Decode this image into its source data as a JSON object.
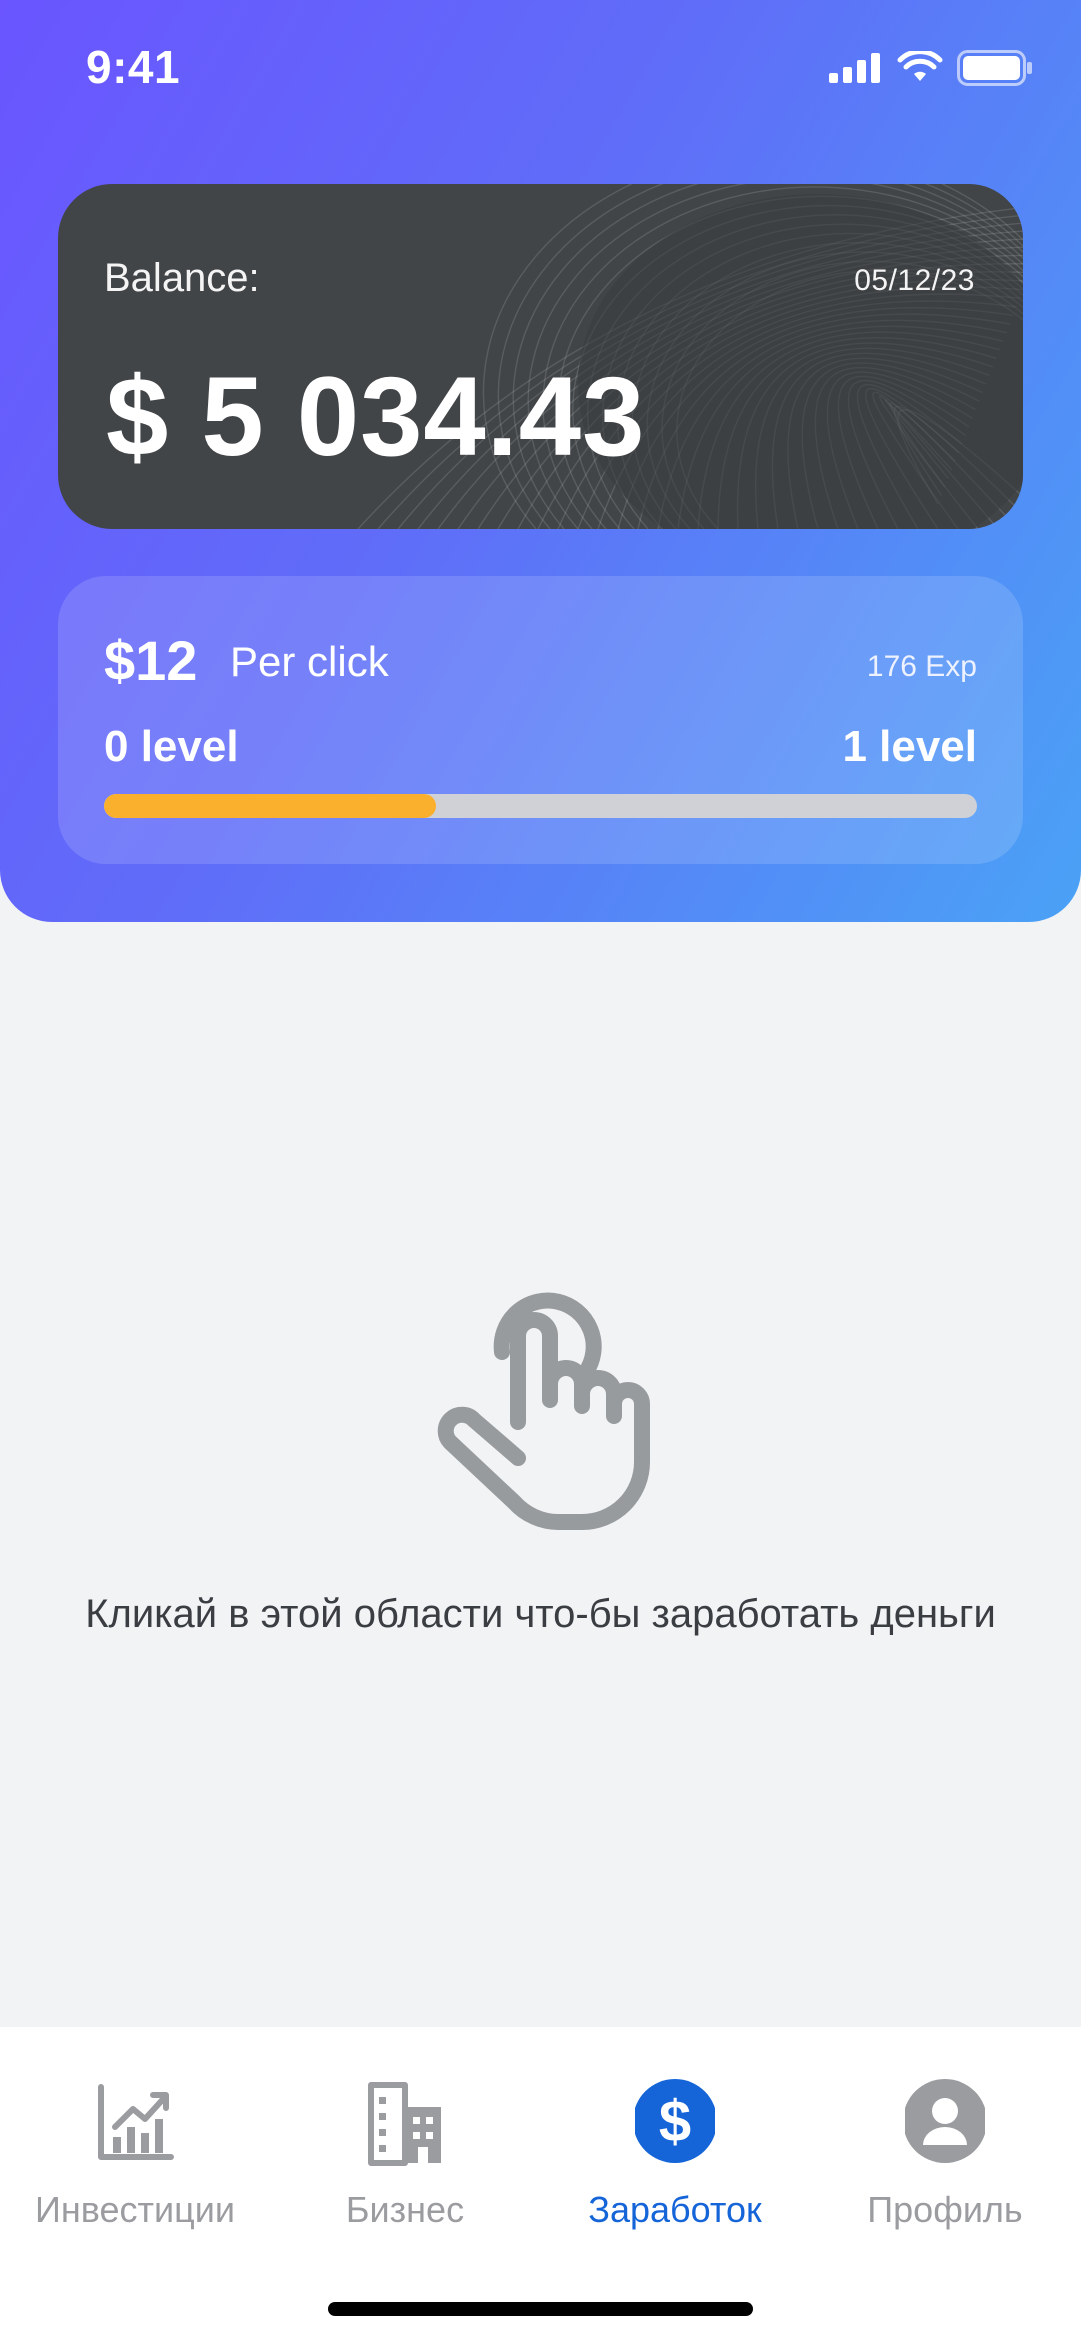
{
  "status_bar": {
    "time": "9:41"
  },
  "balance_card": {
    "label": "Balance:",
    "date": "05/12/23",
    "amount": "$ 5 034.43"
  },
  "click_card": {
    "per_click_value": "$12",
    "per_click_label": "Per click",
    "exp": "176 Exp",
    "current_level": "0 level",
    "next_level": "1 level",
    "progress_fraction": 0.38
  },
  "tap_area": {
    "hint": "Кликай в этой области что-бы заработать деньги"
  },
  "tabs": [
    {
      "label": "Инвестиции",
      "icon": "chart-icon",
      "active": false
    },
    {
      "label": "Бизнес",
      "icon": "building-icon",
      "active": false
    },
    {
      "label": "Заработок",
      "icon": "dollar-icon",
      "active": true
    },
    {
      "label": "Профиль",
      "icon": "profile-icon",
      "active": false
    }
  ],
  "colors": {
    "gradient_start": "#6a55ff",
    "gradient_end": "#4aa2f6",
    "balance_card": "#424548",
    "progress": "#fbb02d",
    "active_tab": "#1565d8",
    "inactive_tab": "#9a9ca0"
  }
}
